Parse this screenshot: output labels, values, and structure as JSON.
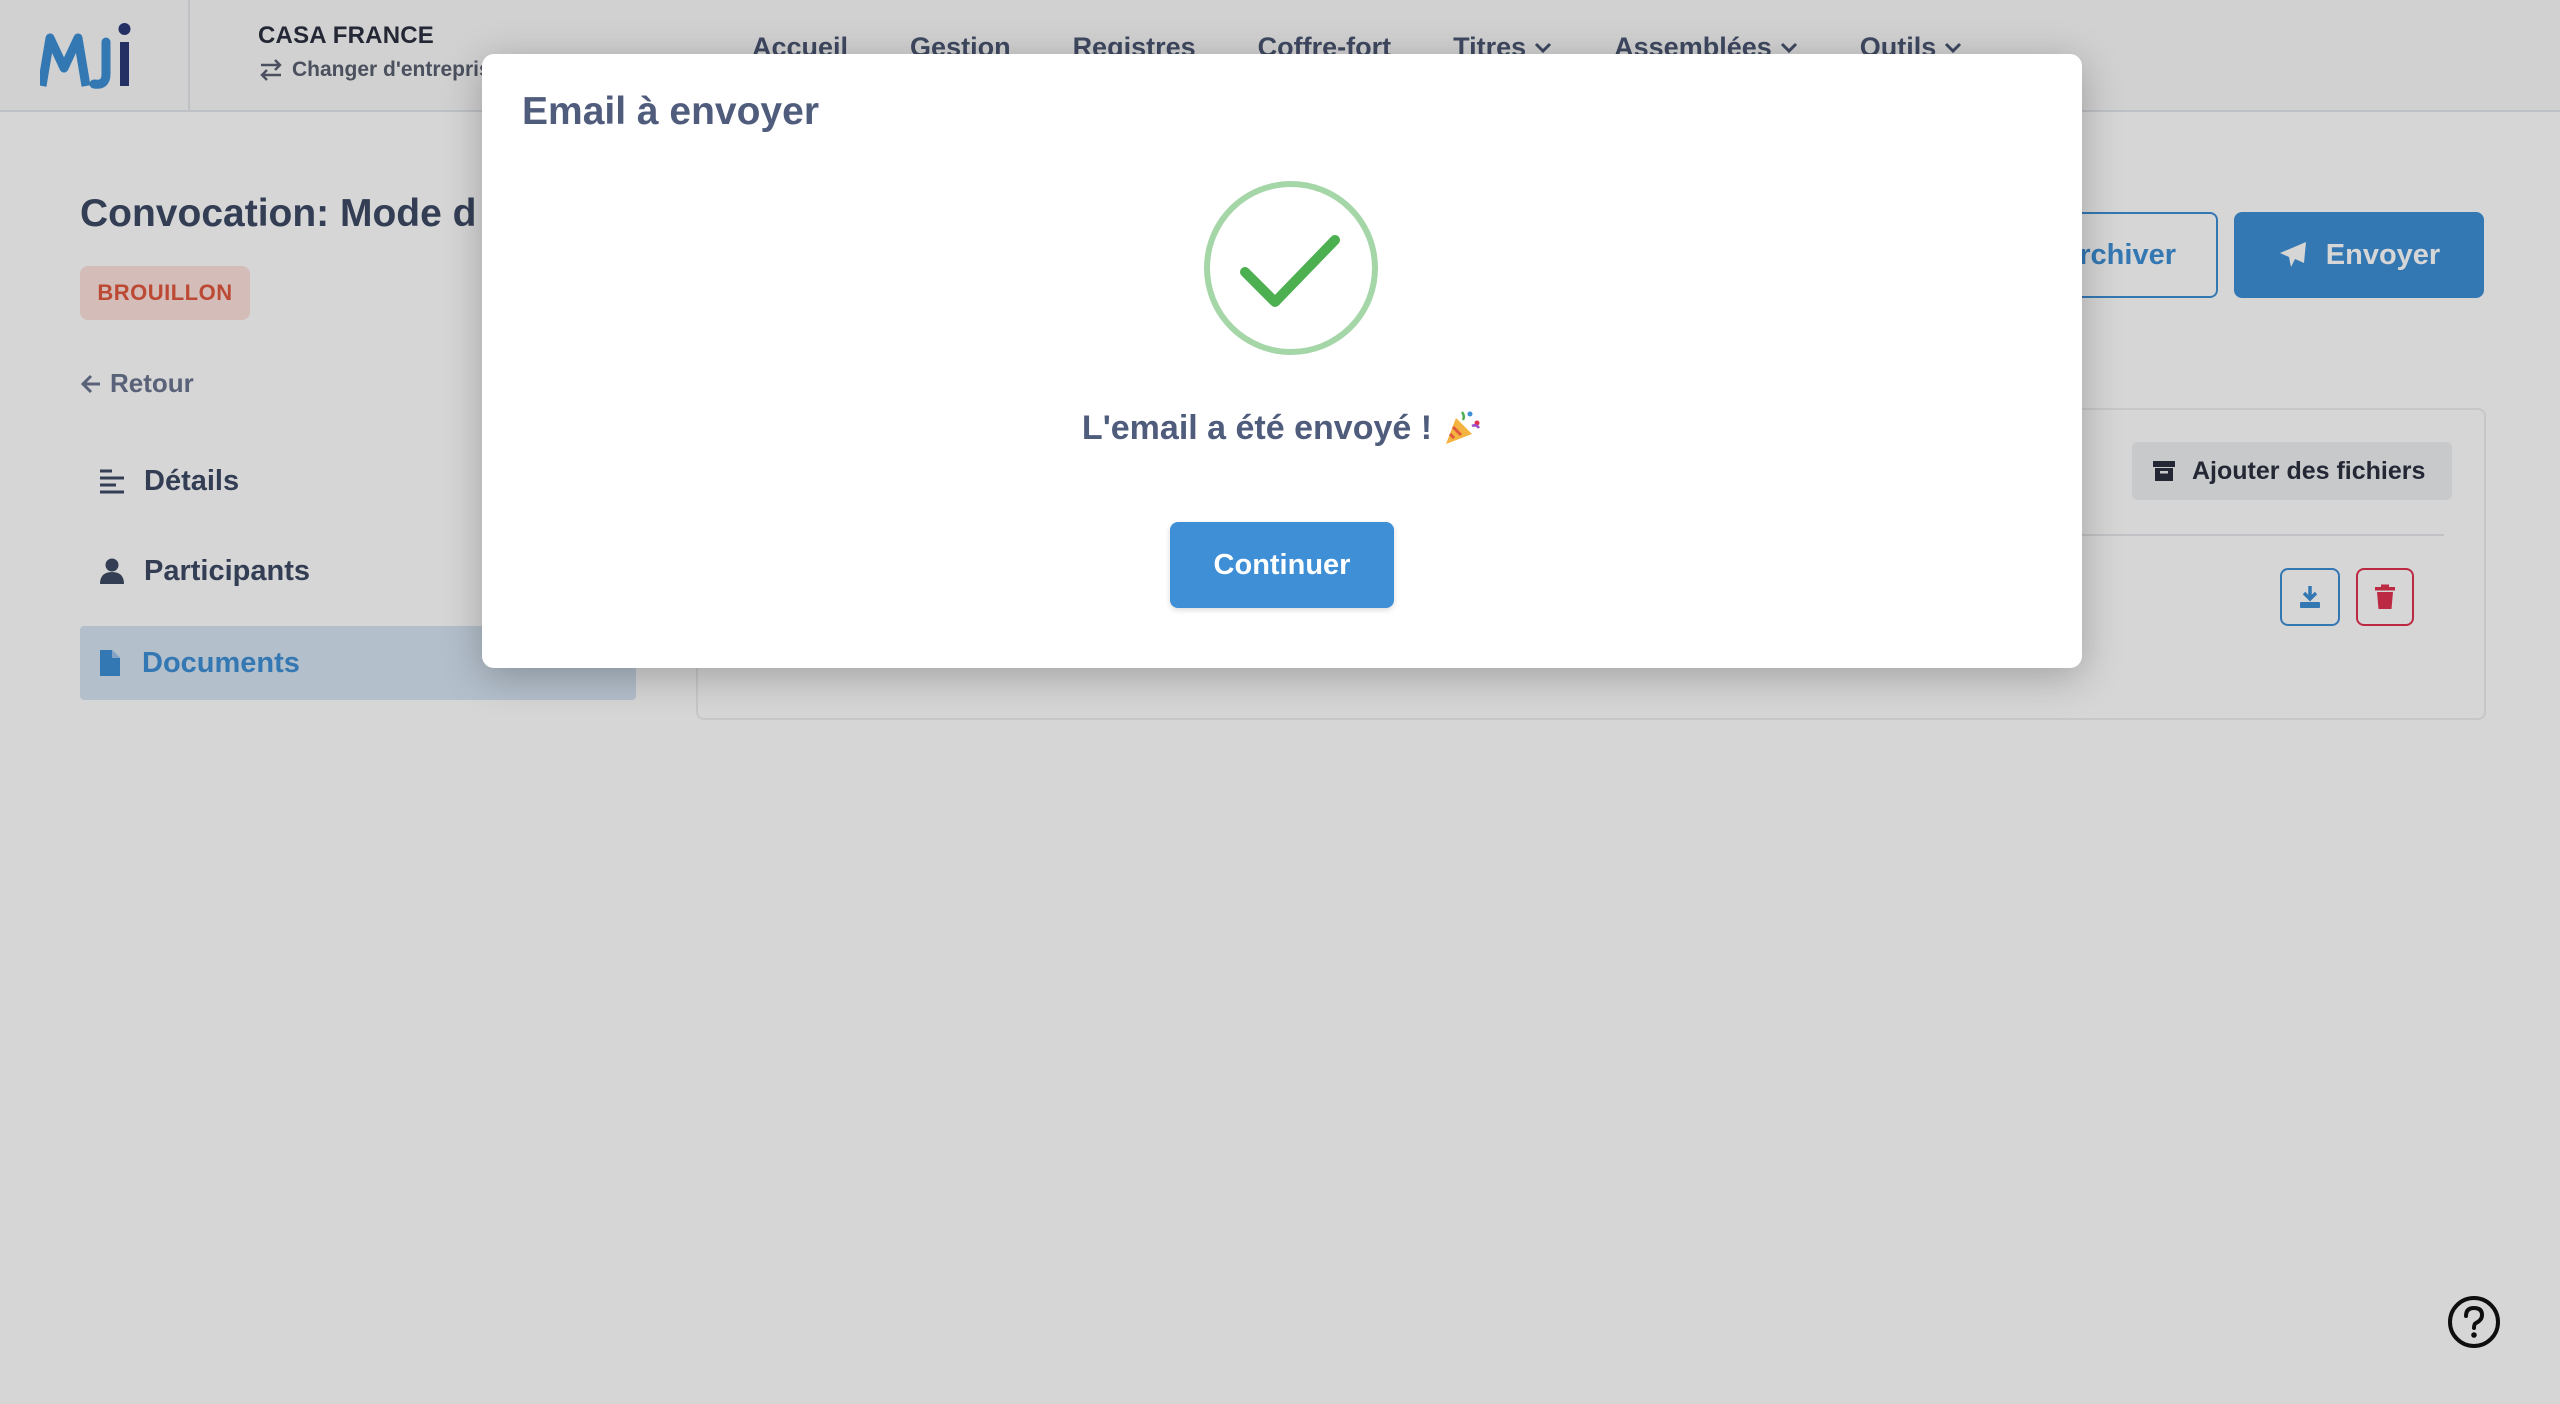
{
  "header": {
    "company_name": "CASA FRANCE",
    "switch_company": "Changer d'entreprise",
    "nav": [
      {
        "label": "Accueil"
      },
      {
        "label": "Gestion"
      },
      {
        "label": "Registres"
      },
      {
        "label": "Coffre-fort"
      },
      {
        "label": "Titres"
      },
      {
        "label": "Assemblées"
      },
      {
        "label": "Outils"
      }
    ]
  },
  "main": {
    "title": "Convocation: Mode d",
    "status": "BROUILLON",
    "back": "Retour",
    "sidebar": [
      {
        "label": "Détails",
        "icon": "align-left-icon"
      },
      {
        "label": "Participants",
        "icon": "user-icon"
      },
      {
        "label": "Documents",
        "icon": "file-icon",
        "active": true
      }
    ],
    "actions": {
      "archive": "Archiver",
      "send": "Envoyer"
    },
    "documents": {
      "add_files": "Ajouter des fichiers"
    }
  },
  "modal": {
    "title": "Email à envoyer",
    "message": "L'email a été envoyé !",
    "continue": "Continuer"
  },
  "colors": {
    "primary": "#3e8fd6",
    "danger": "#e0324f",
    "success": "#4caf50",
    "success_ring": "#a5d6a7",
    "badge_bg": "#fde0dc",
    "badge_text": "#e0583f"
  }
}
